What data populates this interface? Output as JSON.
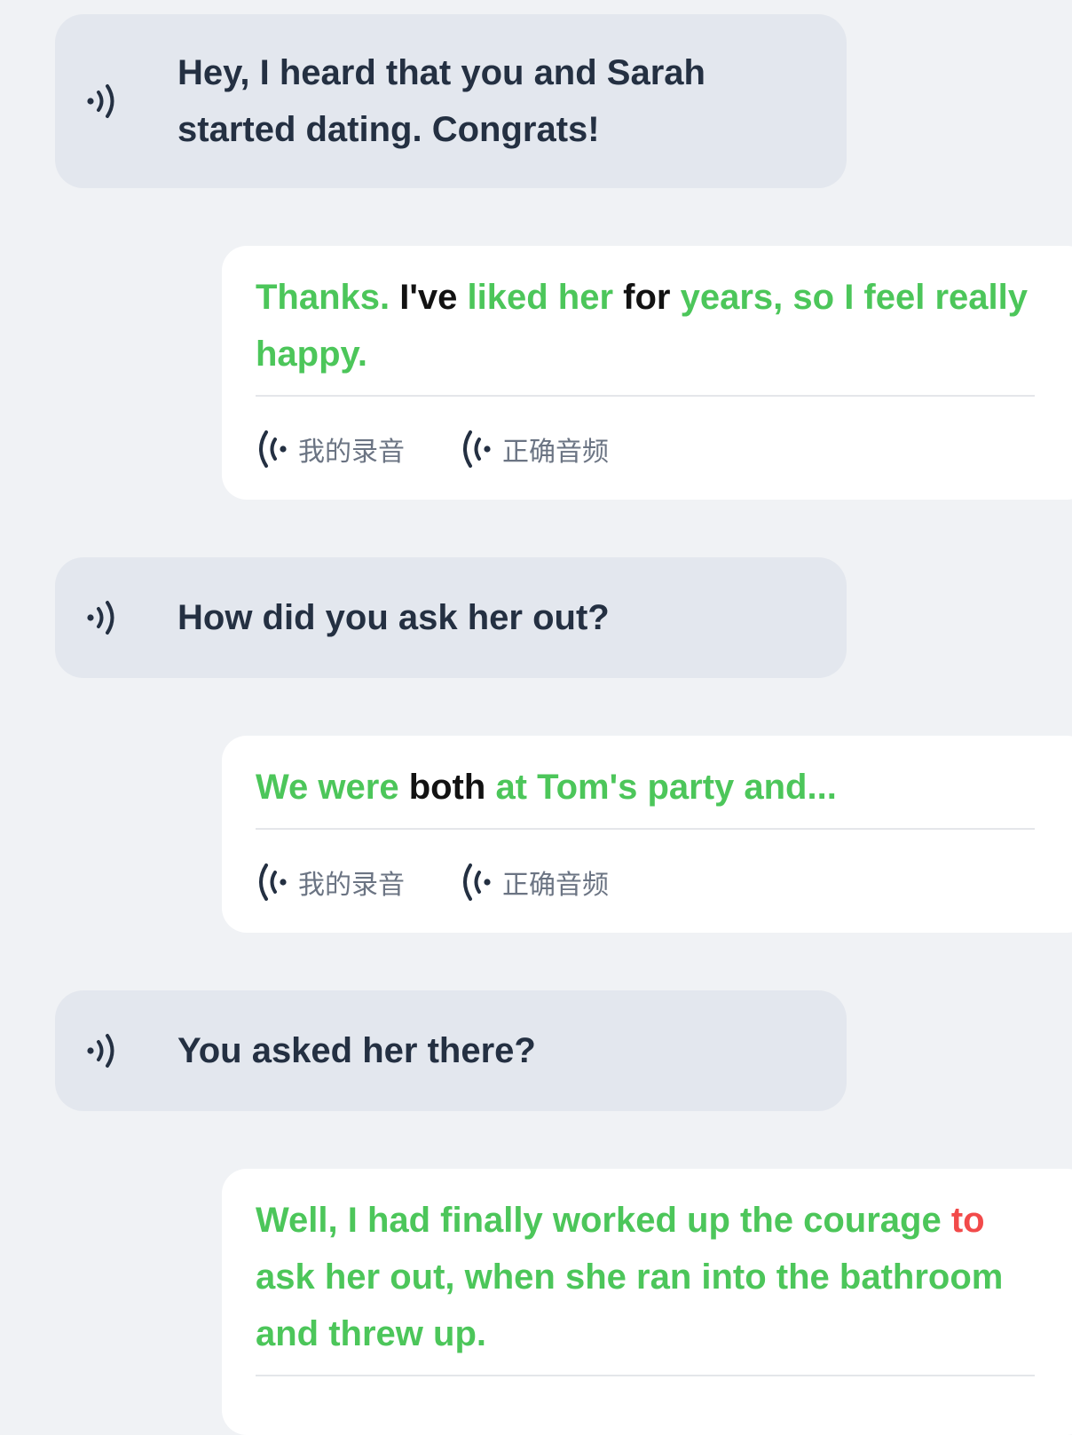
{
  "colors": {
    "correct_word": "#4cc65a",
    "neutral_word": "#121212",
    "wrong_word": "#f24a4a",
    "incoming_bubble": "#e3e7ee",
    "incoming_text": "#243042",
    "page_background": "#f0f2f5"
  },
  "icons": {
    "incoming_play": "speaker-waves-icon",
    "audio_button": "signal-waves-icon"
  },
  "messages": [
    {
      "role": "partner",
      "text": "Hey, I heard that you and Sarah started dating. Congrats!"
    },
    {
      "role": "learner",
      "words": [
        {
          "t": "Thanks.",
          "s": "correct"
        },
        {
          "t": "I've",
          "s": "neutral"
        },
        {
          "t": "liked her",
          "s": "correct"
        },
        {
          "t": "for",
          "s": "neutral"
        },
        {
          "t": "years, so I feel really happy.",
          "s": "correct"
        }
      ],
      "my_recording_label": "我的录音",
      "correct_audio_label": "正确音频"
    },
    {
      "role": "partner",
      "text": "How did you ask her out?"
    },
    {
      "role": "learner",
      "words": [
        {
          "t": "We were",
          "s": "correct"
        },
        {
          "t": "both",
          "s": "neutral"
        },
        {
          "t": "at Tom's party and...",
          "s": "correct"
        }
      ],
      "my_recording_label": "我的录音",
      "correct_audio_label": "正确音频"
    },
    {
      "role": "partner",
      "text": "You asked her there?"
    },
    {
      "role": "learner",
      "words": [
        {
          "t": "Well, I had finally worked up the courage",
          "s": "correct"
        },
        {
          "t": "to",
          "s": "wrong"
        },
        {
          "t": "ask her out, when she ran into the bathroom and threw up.",
          "s": "correct"
        }
      ]
    }
  ]
}
